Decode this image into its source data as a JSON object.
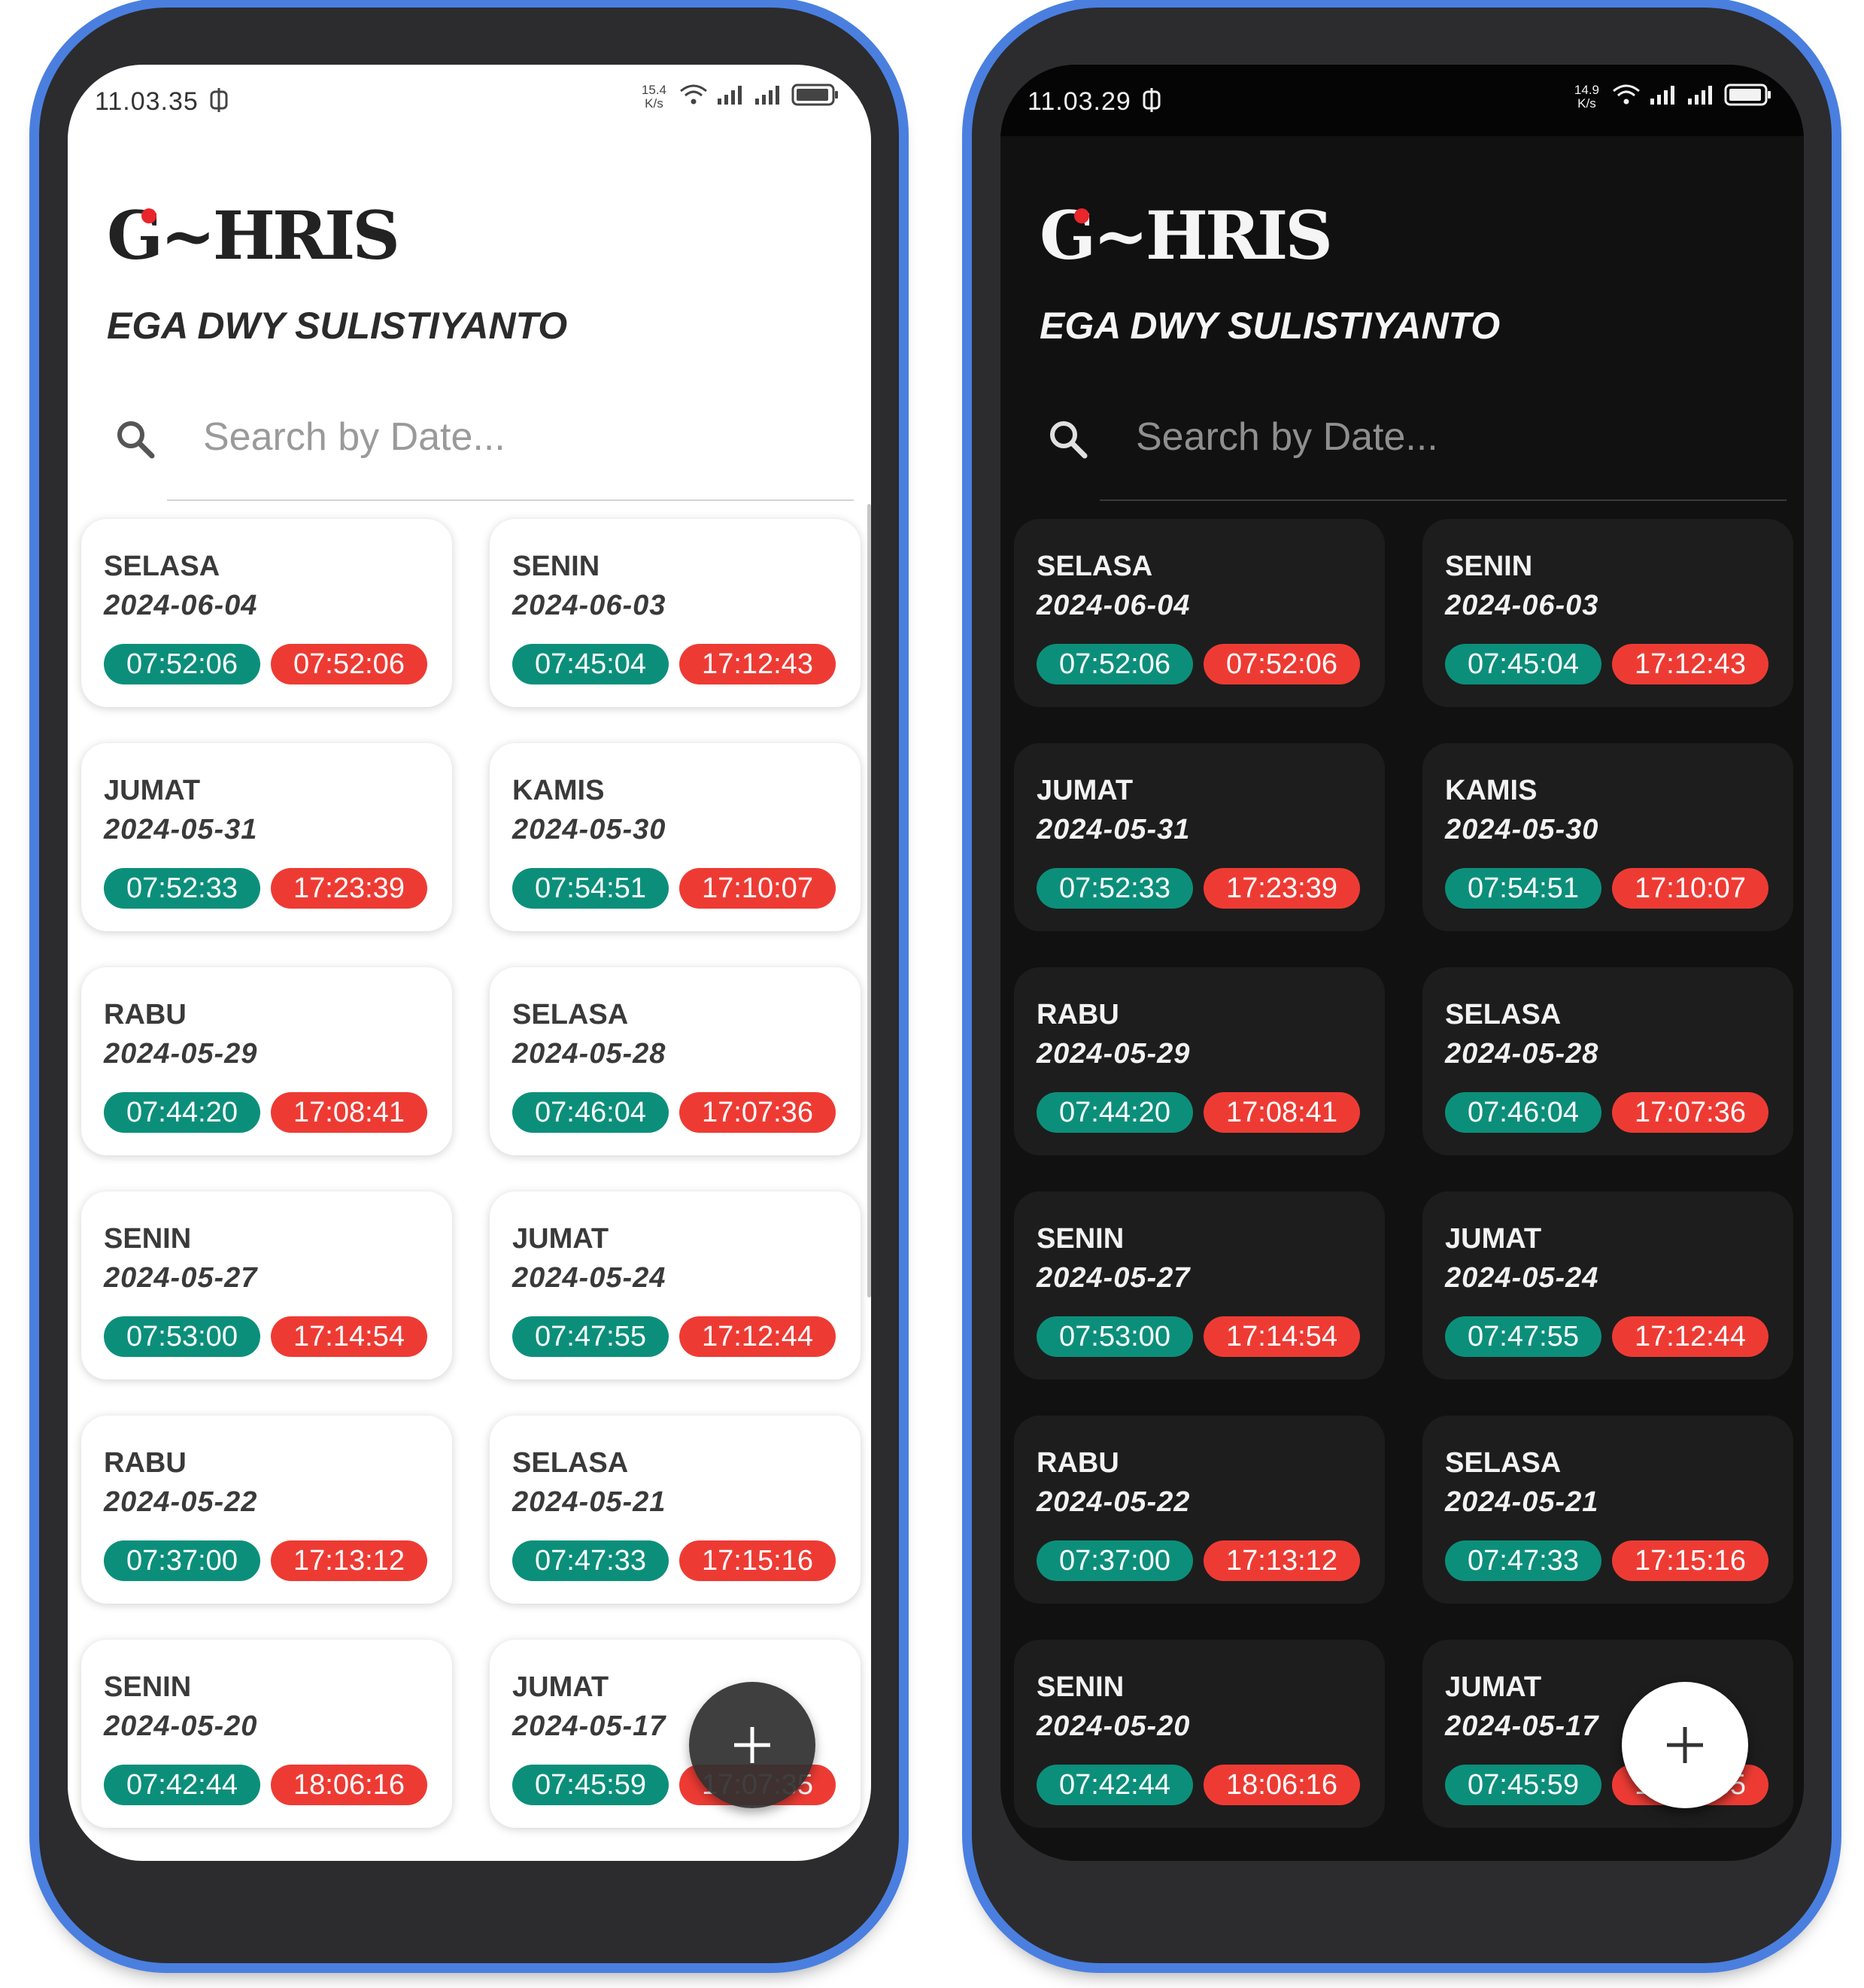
{
  "phones": [
    {
      "theme": "light",
      "status": {
        "time": "11.03.35",
        "speed_value": "15.4",
        "speed_unit": "K/s"
      },
      "app": {
        "logo_g": "G",
        "logo_rest": "~HRIS",
        "user_name": "EGA DWY SULISTIYANTO"
      },
      "search": {
        "placeholder": "Search by Date..."
      },
      "records": [
        {
          "day": "SELASA",
          "date": "2024-06-04",
          "check_in": "07:52:06",
          "check_out": "07:52:06"
        },
        {
          "day": "SENIN",
          "date": "2024-06-03",
          "check_in": "07:45:04",
          "check_out": "17:12:43"
        },
        {
          "day": "JUMAT",
          "date": "2024-05-31",
          "check_in": "07:52:33",
          "check_out": "17:23:39"
        },
        {
          "day": "KAMIS",
          "date": "2024-05-30",
          "check_in": "07:54:51",
          "check_out": "17:10:07"
        },
        {
          "day": "RABU",
          "date": "2024-05-29",
          "check_in": "07:44:20",
          "check_out": "17:08:41"
        },
        {
          "day": "SELASA",
          "date": "2024-05-28",
          "check_in": "07:46:04",
          "check_out": "17:07:36"
        },
        {
          "day": "SENIN",
          "date": "2024-05-27",
          "check_in": "07:53:00",
          "check_out": "17:14:54"
        },
        {
          "day": "JUMAT",
          "date": "2024-05-24",
          "check_in": "07:47:55",
          "check_out": "17:12:44"
        },
        {
          "day": "RABU",
          "date": "2024-05-22",
          "check_in": "07:37:00",
          "check_out": "17:13:12"
        },
        {
          "day": "SELASA",
          "date": "2024-05-21",
          "check_in": "07:47:33",
          "check_out": "17:15:16"
        },
        {
          "day": "SENIN",
          "date": "2024-05-20",
          "check_in": "07:42:44",
          "check_out": "18:06:16"
        },
        {
          "day": "JUMAT",
          "date": "2024-05-17",
          "check_in": "07:45:59",
          "check_out": "17:07:35"
        }
      ]
    },
    {
      "theme": "dark",
      "status": {
        "time": "11.03.29",
        "speed_value": "14.9",
        "speed_unit": "K/s"
      },
      "app": {
        "logo_g": "G",
        "logo_rest": "~HRIS",
        "user_name": "EGA DWY SULISTIYANTO"
      },
      "search": {
        "placeholder": "Search by Date..."
      },
      "records": [
        {
          "day": "SELASA",
          "date": "2024-06-04",
          "check_in": "07:52:06",
          "check_out": "07:52:06"
        },
        {
          "day": "SENIN",
          "date": "2024-06-03",
          "check_in": "07:45:04",
          "check_out": "17:12:43"
        },
        {
          "day": "JUMAT",
          "date": "2024-05-31",
          "check_in": "07:52:33",
          "check_out": "17:23:39"
        },
        {
          "day": "KAMIS",
          "date": "2024-05-30",
          "check_in": "07:54:51",
          "check_out": "17:10:07"
        },
        {
          "day": "RABU",
          "date": "2024-05-29",
          "check_in": "07:44:20",
          "check_out": "17:08:41"
        },
        {
          "day": "SELASA",
          "date": "2024-05-28",
          "check_in": "07:46:04",
          "check_out": "17:07:36"
        },
        {
          "day": "SENIN",
          "date": "2024-05-27",
          "check_in": "07:53:00",
          "check_out": "17:14:54"
        },
        {
          "day": "JUMAT",
          "date": "2024-05-24",
          "check_in": "07:47:55",
          "check_out": "17:12:44"
        },
        {
          "day": "RABU",
          "date": "2024-05-22",
          "check_in": "07:37:00",
          "check_out": "17:13:12"
        },
        {
          "day": "SELASA",
          "date": "2024-05-21",
          "check_in": "07:47:33",
          "check_out": "17:15:16"
        },
        {
          "day": "SENIN",
          "date": "2024-05-20",
          "check_in": "07:42:44",
          "check_out": "18:06:16"
        },
        {
          "day": "JUMAT",
          "date": "2024-05-17",
          "check_in": "07:45:59",
          "check_out": "17:07:35"
        }
      ]
    }
  ],
  "icons": {
    "search": "search-icon",
    "add": "plus-icon",
    "wifi": "wifi-icon",
    "signal": "signal-icon",
    "battery": "battery-icon",
    "sync": "sync-icon"
  },
  "colors": {
    "check_in": "#0c8f7a",
    "check_out": "#ed3b34",
    "logo_dot": "#e8262c",
    "frame_accent": "#4a7fe0"
  }
}
